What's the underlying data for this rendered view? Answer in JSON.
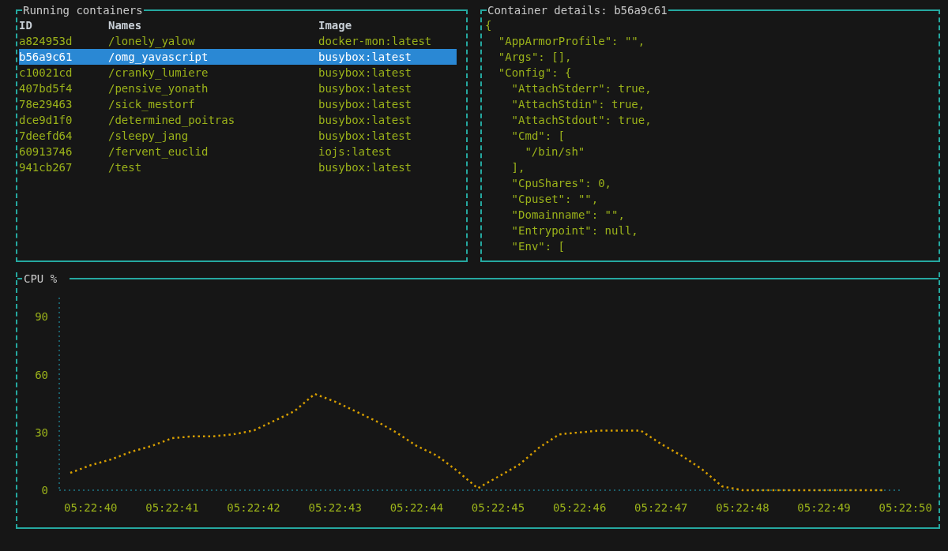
{
  "containers": {
    "title": "Running containers",
    "columns": [
      "ID",
      "Names",
      "Image"
    ],
    "rows": [
      {
        "cells": [
          "a824953d",
          "/lonely_yalow",
          "docker-mon:latest"
        ],
        "selected": false
      },
      {
        "cells": [
          "b56a9c61",
          "/omg_yavascript",
          "busybox:latest"
        ],
        "selected": true
      },
      {
        "cells": [
          "c10021cd",
          "/cranky_lumiere",
          "busybox:latest"
        ],
        "selected": false
      },
      {
        "cells": [
          "407bd5f4",
          "/pensive_yonath",
          "busybox:latest"
        ],
        "selected": false
      },
      {
        "cells": [
          "78e29463",
          "/sick_mestorf",
          "busybox:latest"
        ],
        "selected": false
      },
      {
        "cells": [
          "dce9d1f0",
          "/determined_poitras",
          "busybox:latest"
        ],
        "selected": false
      },
      {
        "cells": [
          "7deefd64",
          "/sleepy_jang",
          "busybox:latest"
        ],
        "selected": false
      },
      {
        "cells": [
          "60913746",
          "/fervent_euclid",
          "iojs:latest"
        ],
        "selected": false
      },
      {
        "cells": [
          "941cb267",
          "/test",
          "busybox:latest"
        ],
        "selected": false
      }
    ]
  },
  "details": {
    "title": "Container details: b56a9c61",
    "lines": [
      {
        "text": "{",
        "children": [
          {
            "text": "\"AppArmorProfile\": \"\","
          },
          {
            "text": "\"Args\": [],"
          },
          {
            "text": "\"Config\": {",
            "children": [
              {
                "text": "\"AttachStderr\": true,"
              },
              {
                "text": "\"AttachStdin\": true,"
              },
              {
                "text": "\"AttachStdout\": true,"
              },
              {
                "text": "\"Cmd\": [",
                "children": [
                  {
                    "text": "\"/bin/sh\""
                  }
                ]
              },
              {
                "text": "],"
              },
              {
                "text": "\"CpuShares\": 0,"
              },
              {
                "text": "\"Cpuset\": \"\","
              },
              {
                "text": "\"Domainname\": \"\","
              },
              {
                "text": "\"Entrypoint\": null,"
              },
              {
                "text": "\"Env\": ["
              }
            ]
          }
        ]
      }
    ]
  },
  "cpu": {
    "chart_data": {
      "type": "line",
      "ylim": [
        0,
        100
      ],
      "categories": [
        null,
        "05:22:40",
        null,
        null,
        null,
        "05:22:41",
        null,
        null,
        null,
        "05:22:42",
        null,
        null,
        null,
        "05:22:43",
        null,
        null,
        null,
        "05:22:44",
        null,
        null,
        null,
        "05:22:45",
        null,
        null,
        null,
        "05:22:46",
        null,
        null,
        null,
        "05:22:47",
        null,
        null,
        null,
        "05:22:48",
        null,
        null,
        null,
        "05:22:49",
        null,
        null,
        null,
        "05:22:50"
      ],
      "yticks": [
        {
          "value": 0,
          "label": "0"
        },
        {
          "value": 30,
          "label": "30"
        },
        {
          "value": 60,
          "label": "60"
        },
        {
          "value": 90,
          "label": "90"
        }
      ],
      "series": [
        {
          "name": "CPU %",
          "color": "#d69e00",
          "line_style": "dotted",
          "values": [
            9,
            13,
            16,
            20,
            23,
            27,
            28,
            28,
            29,
            31,
            36,
            41,
            50,
            46,
            41,
            36,
            30,
            23,
            18,
            10,
            1,
            7,
            13,
            22,
            29,
            30,
            31,
            31,
            31,
            24,
            18,
            11,
            2,
            0,
            0,
            0,
            0,
            0,
            0,
            0,
            0,
            null
          ]
        }
      ]
    }
  }
}
